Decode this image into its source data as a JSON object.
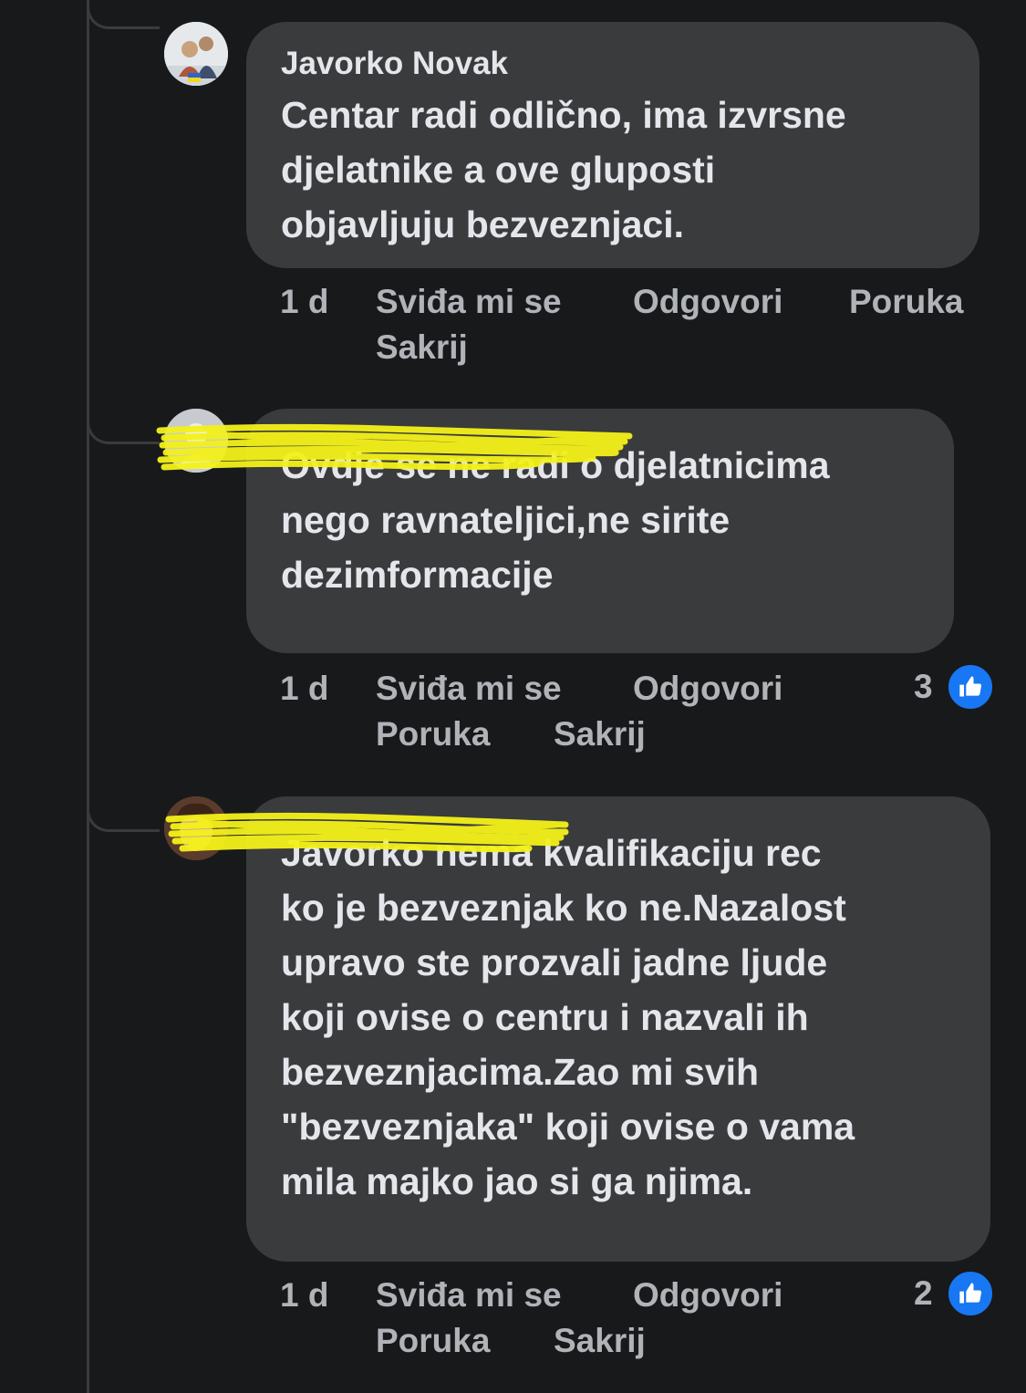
{
  "comments": [
    {
      "author": "Javorko Novak",
      "text": "Centar radi odlično, ima izvrsne djelatnike a ove gluposti objavljuju bezveznjaci.",
      "lines": [
        "Centar radi odlično, ima izvrsne",
        "djelatnike a ove gluposti",
        "objavljuju bezveznjaci."
      ],
      "time": "1 d",
      "like_label": "Sviđa mi se",
      "reply_label": "Odgovori",
      "message_label": "Poruka",
      "hide_label": "Sakrij"
    },
    {
      "author": "",
      "text": "Ovdje se ne radi o djelatnicima nego ravnateljici,ne sirite dezimformacije",
      "lines": [
        "Ovdje se ne radi o djelatnicima",
        "nego ravnateljici,ne sirite",
        "dezimformacije"
      ],
      "time": "1 d",
      "like_label": "Sviđa mi se",
      "reply_label": "Odgovori",
      "message_label": "Poruka",
      "hide_label": "Sakrij",
      "reactions": "3"
    },
    {
      "author": "",
      "text": "Javorko nema kvalifikaciju rec ko je bezveznjak ko ne.Nazalost upravo ste prozvali jadne ljude koji ovise o centru i nazvali ih bezveznjacima.Zao mi svih \"bezveznjaka\" koji ovise o vama mila majko jao si ga njima.",
      "lines": [
        "Javorko nema kvalifikaciju rec",
        "ko je bezveznjak ko ne.Nazalost",
        "upravo ste prozvali jadne ljude",
        "koji ovise o centru i nazvali ih",
        "bezveznjacima.Zao mi svih",
        "\"bezveznjaka\" koji ovise o vama",
        "mila majko jao si ga njima."
      ],
      "time": "1 d",
      "like_label": "Sviđa mi se",
      "reply_label": "Odgovori",
      "message_label": "Poruka",
      "hide_label": "Sakrij",
      "reactions": "2"
    }
  ],
  "colors": {
    "background": "#18191a",
    "bubble": "#3a3b3c",
    "text": "#e4e6eb",
    "muted": "#b0b3b8",
    "like_blue": "#1877f2",
    "redaction_yellow": "#f4f21a"
  },
  "icons": {
    "like": "thumbs-up-icon"
  }
}
